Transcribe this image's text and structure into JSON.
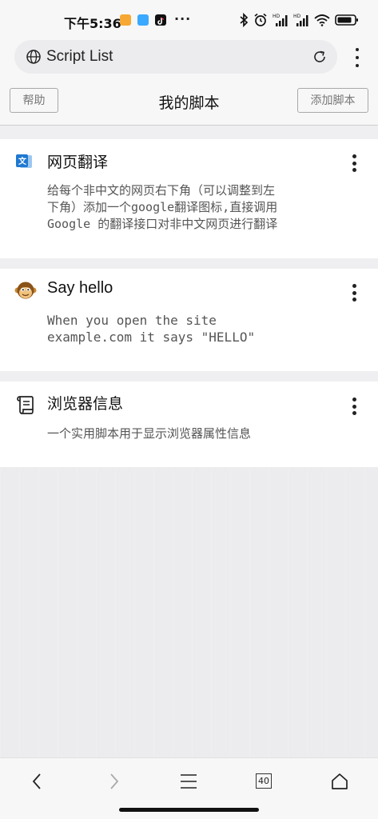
{
  "status_bar": {
    "time": "下午5:36",
    "app_icons": [
      "gallery-icon",
      "chat-icon",
      "tiktok-icon"
    ],
    "overflow": "···",
    "right_icons": [
      "bluetooth-icon",
      "alarm-icon",
      "signal-hd-icon",
      "signal-hd-icon",
      "wifi-icon",
      "battery-icon"
    ],
    "signal_label": "HD",
    "colors": {
      "gallery": "#f7a734",
      "chat": "#3aa9ff",
      "tiktok": "#111111"
    }
  },
  "browser": {
    "address_text": "Script List",
    "icons": {
      "left": "globe-icon",
      "right": "reload-icon",
      "menu": "kebab-menu-icon"
    }
  },
  "header": {
    "help_label": "帮助",
    "title": "我的脚本",
    "add_label": "添加脚本"
  },
  "scripts": [
    {
      "icon": "translate-icon",
      "title": "网页翻译",
      "description": "给每个非中文的网页右下角（可以调整到左\n下角）添加一个google翻译图标,直接调用\nGoogle 的翻译接口对非中文网页进行翻译"
    },
    {
      "icon": "monkey-icon",
      "title": "Say hello",
      "description": "When you open the site\nexample.com it says \"HELLO\""
    },
    {
      "icon": "scroll-icon",
      "title": "浏览器信息",
      "description": "一个实用脚本用于显示浏览器属性信息"
    }
  ],
  "bottom_nav": {
    "tab_count": "40",
    "items": [
      "back-icon",
      "forward-icon",
      "menu-icon",
      "tabs-icon",
      "home-icon"
    ]
  }
}
